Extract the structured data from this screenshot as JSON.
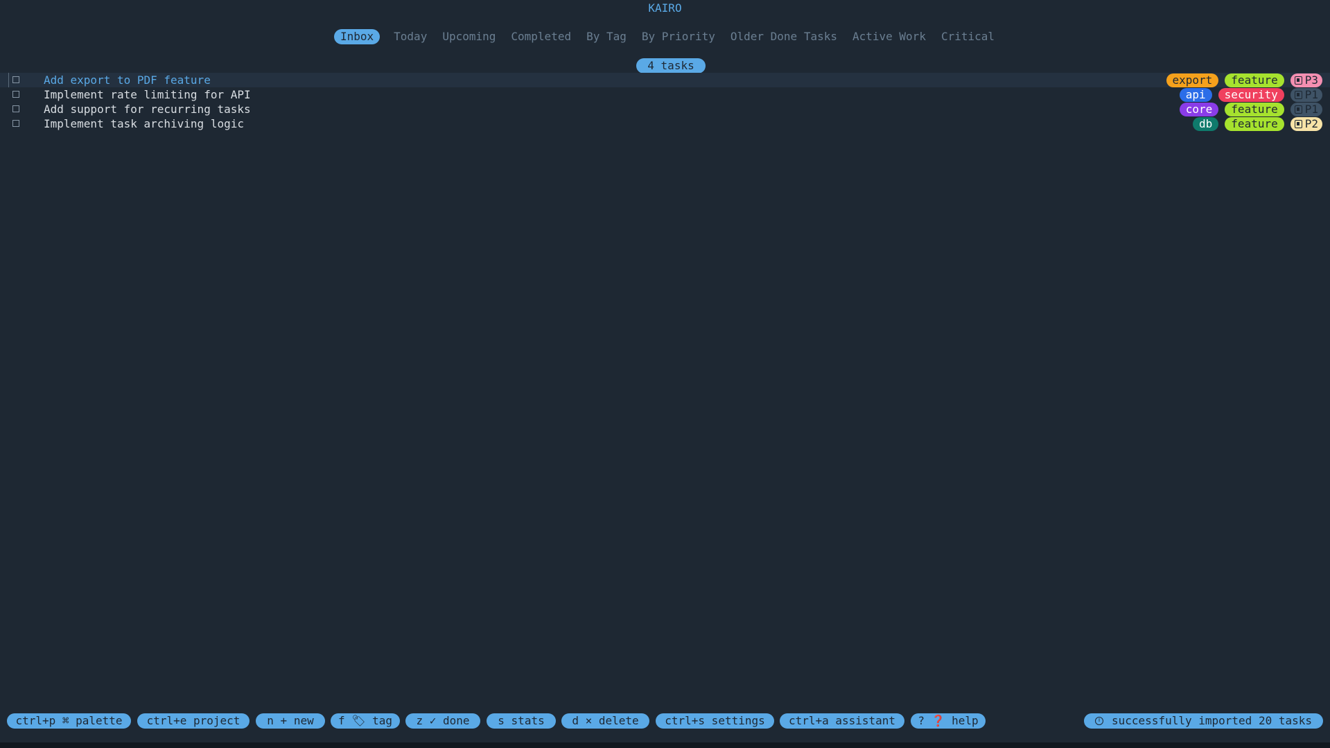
{
  "app": {
    "title": "KAIRO"
  },
  "tabs": [
    {
      "label": "Inbox",
      "active": true
    },
    {
      "label": "Today",
      "active": false
    },
    {
      "label": "Upcoming",
      "active": false
    },
    {
      "label": "Completed",
      "active": false
    },
    {
      "label": "By Tag",
      "active": false
    },
    {
      "label": "By Priority",
      "active": false
    },
    {
      "label": "Older Done Tasks",
      "active": false
    },
    {
      "label": "Active Work",
      "active": false
    },
    {
      "label": "Critical",
      "active": false
    }
  ],
  "task_count_label": "4 tasks",
  "tasks": [
    {
      "title": "Add export to PDF feature",
      "selected": true,
      "tags": [
        {
          "label": "export",
          "color": "#f5a11c",
          "text_color": "#1e2833"
        },
        {
          "label": "feature",
          "color": "#a6e22e",
          "text_color": "#1e2833"
        }
      ],
      "priority": {
        "label": "P3",
        "bg": "#f48fb1",
        "fg": "#1e2833",
        "icon": "note-icon"
      }
    },
    {
      "title": "Implement rate limiting for API",
      "selected": false,
      "tags": [
        {
          "label": "api",
          "color": "#2b6de8",
          "text_color": "#ffffff"
        },
        {
          "label": "security",
          "color": "#f0405e",
          "text_color": "#ffffff"
        }
      ],
      "priority": {
        "label": "P1",
        "bg": "#3f5366",
        "fg": "#1e2833",
        "icon": "note-icon"
      }
    },
    {
      "title": "Add support for recurring tasks",
      "selected": false,
      "tags": [
        {
          "label": "core",
          "color": "#8a3ce8",
          "text_color": "#ffffff"
        },
        {
          "label": "feature",
          "color": "#a6e22e",
          "text_color": "#1e2833"
        }
      ],
      "priority": {
        "label": "P1",
        "bg": "#3f5366",
        "fg": "#1e2833",
        "icon": "note-icon"
      }
    },
    {
      "title": "Implement task archiving logic",
      "selected": false,
      "tags": [
        {
          "label": "db",
          "color": "#0f7a6c",
          "text_color": "#ffffff"
        },
        {
          "label": "feature",
          "color": "#a6e22e",
          "text_color": "#1e2833"
        }
      ],
      "priority": {
        "label": "P2",
        "bg": "#f7e3a7",
        "fg": "#1e2833",
        "icon": "note-icon"
      }
    }
  ],
  "footer": {
    "hints": [
      {
        "label": "ctrl+p ⌘ palette"
      },
      {
        "label": "ctrl+e project"
      },
      {
        "label": "n + new"
      },
      {
        "label": "f 🏷 tag"
      },
      {
        "label": "z ✓ done"
      },
      {
        "label": "s stats"
      },
      {
        "label": "d × delete"
      },
      {
        "label": "ctrl+s settings"
      },
      {
        "label": "ctrl+a assistant"
      },
      {
        "label": "? ❓ help"
      }
    ],
    "status": {
      "label": "successfully imported 20 tasks",
      "icon": "info-icon"
    }
  },
  "colors": {
    "background": "#1e2833",
    "accent": "#5aa9e6",
    "muted_text": "#6b7f92",
    "selected_row": "#243140"
  }
}
